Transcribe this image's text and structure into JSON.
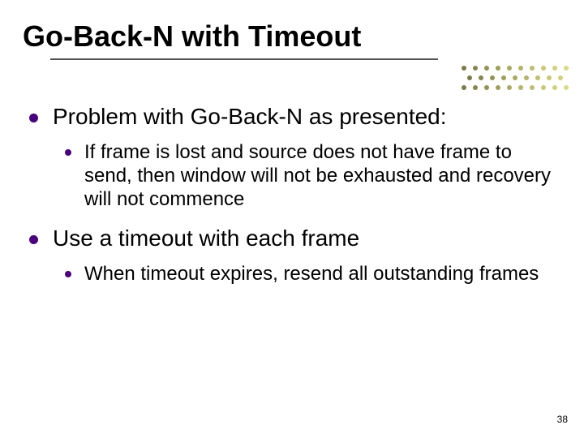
{
  "slide": {
    "title": "Go-Back-N with Timeout",
    "bullets": [
      {
        "text": "Problem with Go-Back-N as presented:",
        "sub": [
          "If frame is lost and source does not have frame to send, then window will not be exhausted and recovery will not commence"
        ]
      },
      {
        "text": "Use a timeout with each frame",
        "sub": [
          "When timeout expires, resend all outstanding frames"
        ]
      }
    ],
    "page_number": "38"
  },
  "colors": {
    "bullet": "#4B0082",
    "accent_dots": [
      "#7b7b45",
      "#93934f",
      "#b1b15f",
      "#c7c770"
    ]
  }
}
